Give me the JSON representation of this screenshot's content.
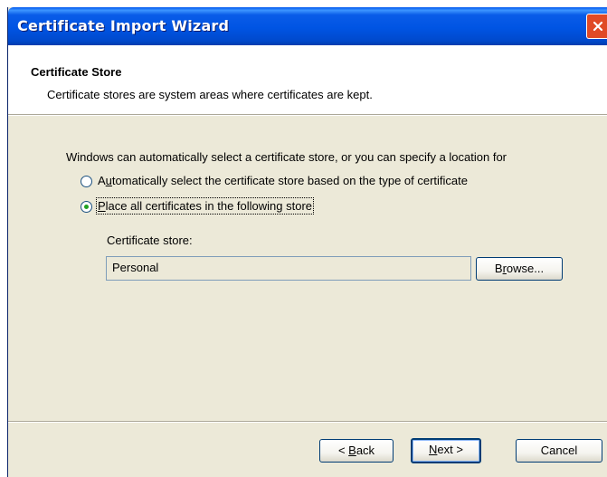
{
  "window": {
    "title": "Certificate Import Wizard"
  },
  "header": {
    "title": "Certificate Store",
    "description": "Certificate stores are system areas where certificates are kept."
  },
  "body": {
    "intro": "Windows can automatically select a certificate store, or you can specify a location for",
    "options": [
      {
        "prefix": "A",
        "access": "u",
        "rest": "tomatically select the certificate store based on the type of certificate",
        "checked": false
      },
      {
        "prefix": "",
        "access": "P",
        "rest": "lace all certificates in the following store",
        "checked": true
      }
    ],
    "store_label": "Certificate store:",
    "store_value": "Personal",
    "browse": {
      "access": "r",
      "prefix": "B",
      "rest": "owse..."
    }
  },
  "footer": {
    "back": {
      "prefix": "< ",
      "access": "B",
      "rest": "ack"
    },
    "next": {
      "access": "N",
      "rest": "ext >"
    },
    "cancel": "Cancel"
  },
  "colors": {
    "titlebar": "#0054e3",
    "dialog": "#ece9d8",
    "close": "#e04a26",
    "radio_dot": "#21a121"
  },
  "icons": {
    "close": "close-icon"
  }
}
